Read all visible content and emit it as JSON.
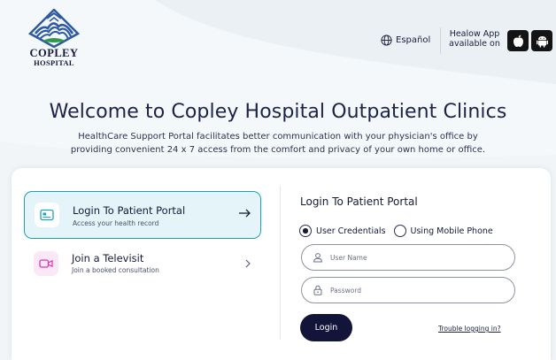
{
  "hospital": {
    "name": "COPLEY",
    "sub": "HOSPITAL"
  },
  "header": {
    "language_label": "Español",
    "healow_line1": "Healow App",
    "healow_line2": "available on"
  },
  "hero": {
    "title": "Welcome to Copley Hospital Outpatient Clinics",
    "description_line1": "HealthCare Support Portal facilitates better communication with your physician's office by",
    "description_line2": "providing convenient 24 x 7 access from the comfort and privacy of your own home or office."
  },
  "options": [
    {
      "title": "Login To Patient Portal",
      "subtitle": "Access your health record",
      "active": true
    },
    {
      "title": "Join a Televisit",
      "subtitle": "Join a booked consultation",
      "active": false
    }
  ],
  "form": {
    "title": "Login To Patient Portal",
    "radio_credentials": "User Credentials",
    "radio_mobile": "Using Mobile Phone",
    "selected_method": "User Credentials",
    "username_placeholder": "User Name",
    "password_placeholder": "Password",
    "username_value": "",
    "password_value": "",
    "login_label": "Login",
    "trouble_label": "Trouble logging in?"
  },
  "colors": {
    "accent": "#1aa3b3",
    "active_bg": "#e5f4f8",
    "primary_dark": "#12143a",
    "logo_blue": "#2c5aa0",
    "logo_green": "#2e9a4a",
    "televisit_icon": "#d63ab0"
  },
  "icons": {
    "language": "globe-icon",
    "apple": "apple-icon",
    "android": "android-icon",
    "portal": "id-card-icon",
    "televisit": "video-camera-icon",
    "active_arrow": "arrow-right-icon",
    "option_chevron": "chevron-right-icon",
    "username": "user-icon",
    "password": "lock-icon"
  }
}
